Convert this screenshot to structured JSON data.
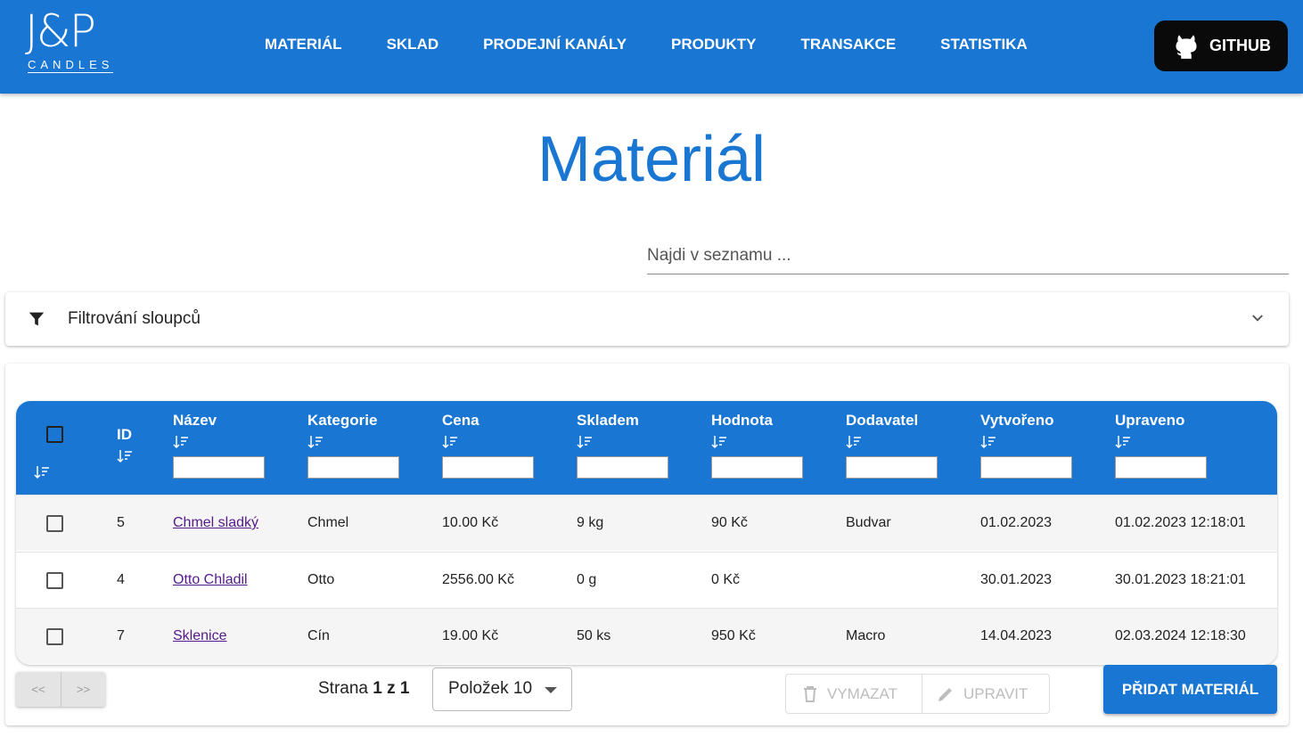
{
  "brand": {
    "mark": "J&P",
    "sub": "CANDLES"
  },
  "nav": {
    "items": [
      {
        "label": "MATERIÁL"
      },
      {
        "label": "SKLAD"
      },
      {
        "label": "PRODEJNÍ KANÁLY"
      },
      {
        "label": "PRODUKTY"
      },
      {
        "label": "TRANSAKCE"
      },
      {
        "label": "STATISTIKA"
      }
    ],
    "github_label": "GITHUB"
  },
  "page": {
    "title": "Materiál"
  },
  "search": {
    "placeholder": "Najdi v seznamu ...",
    "value": ""
  },
  "filter": {
    "label": "Filtrování sloupců"
  },
  "table": {
    "columns": [
      "ID",
      "Název",
      "Kategorie",
      "Cena",
      "Skladem",
      "Hodnota",
      "Dodavatel",
      "Vytvořeno",
      "Upraveno"
    ],
    "rows": [
      {
        "id": "5",
        "name": "Chmel sladký",
        "category": "Chmel",
        "price": "10.00 Kč",
        "stock": "9 kg",
        "value": "90 Kč",
        "supplier": "Budvar",
        "created": "01.02.2023",
        "updated": "01.02.2023 12:18:01"
      },
      {
        "id": "4",
        "name": "Otto Chladil",
        "category": "Otto",
        "price": "2556.00 Kč",
        "stock": "0 g",
        "value": "0 Kč",
        "supplier": "",
        "created": "30.01.2023",
        "updated": "30.01.2023 18:21:01"
      },
      {
        "id": "7",
        "name": "Sklenice",
        "category": "Cín",
        "price": "19.00 Kč",
        "stock": "50 ks",
        "value": "950 Kč",
        "supplier": "Macro",
        "created": "14.04.2023",
        "updated": "02.03.2024 12:18:30"
      }
    ]
  },
  "pagination": {
    "prev_label": "<<",
    "next_label": ">>",
    "page_prefix": "Strana",
    "current": "1",
    "of": "z",
    "total": "1",
    "per_page_label": "Položek 10"
  },
  "actions": {
    "delete_label": "VYMAZAT",
    "edit_label": "UPRAVIT",
    "add_label": "PŘIDAT MATERIÁL"
  },
  "colors": {
    "primary": "#1976d2",
    "github_bg": "#0a0a0a",
    "row_alt": "#f5f5f5",
    "link": "#551a8b"
  }
}
